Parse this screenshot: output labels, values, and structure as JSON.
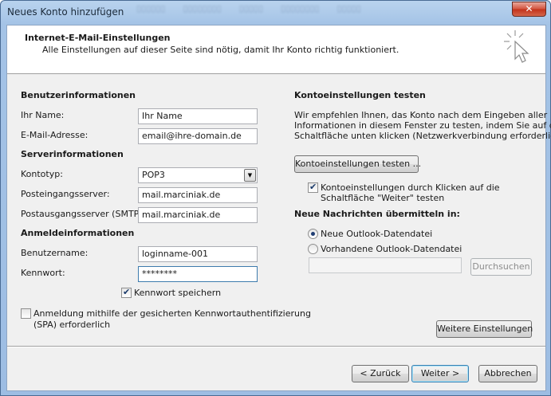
{
  "window": {
    "title": "Neues Konto hinzufügen",
    "close_glyph": "✕"
  },
  "header": {
    "title": "Internet-E-Mail-Einstellungen",
    "subtitle": "Alle Einstellungen auf dieser Seite sind nötig, damit Ihr Konto richtig funktioniert.",
    "icon": "cursor-sparkle-icon"
  },
  "user_info": {
    "heading": "Benutzerinformationen",
    "name_label": "Ihr Name:",
    "name_value": "Ihr Name",
    "email_label": "E-Mail-Adresse:",
    "email_value": "email@ihre-domain.de"
  },
  "server_info": {
    "heading": "Serverinformationen",
    "account_type_label": "Kontotyp:",
    "account_type_value": "POP3",
    "incoming_label": "Posteingangsserver:",
    "incoming_value": "mail.marciniak.de",
    "outgoing_label": "Postausgangsserver (SMTP):",
    "outgoing_value": "mail.marciniak.de"
  },
  "login_info": {
    "heading": "Anmeldeinformationen",
    "username_label": "Benutzername:",
    "username_value": "loginname-001",
    "password_label": "Kennwort:",
    "password_value": "********",
    "remember_password_label": "Kennwort speichern",
    "remember_password_checked": true,
    "spa_label_line1": "Anmeldung mithilfe der gesicherten Kennwortauthentifizierung",
    "spa_label_line2": "(SPA) erforderlich",
    "spa_checked": false
  },
  "test_settings": {
    "heading": "Kontoeinstellungen testen",
    "description_line1": "Wir empfehlen Ihnen, das Konto nach dem Eingeben aller",
    "description_line2": "Informationen in diesem Fenster zu testen, indem Sie auf die",
    "description_line3": "Schaltfläche unten klicken (Netzwerkverbindung erforderlich).",
    "test_button_label": "Kontoeinstellungen testen ...",
    "auto_test_label_line1": "Kontoeinstellungen durch Klicken auf die",
    "auto_test_label_line2": "Schaltfläche \"Weiter\" testen",
    "auto_test_checked": true
  },
  "deliver_to": {
    "heading": "Neue Nachrichten übermitteln in:",
    "option_new_label": "Neue Outlook-Datendatei",
    "option_existing_label": "Vorhandene Outlook-Datendatei",
    "selected": "new",
    "path_value": "",
    "browse_label": "Durchsuchen"
  },
  "more_settings_label": "Weitere Einstellungen",
  "footer": {
    "back_label": "< Zurück",
    "next_label": "Weiter >",
    "cancel_label": "Abbrechen"
  }
}
